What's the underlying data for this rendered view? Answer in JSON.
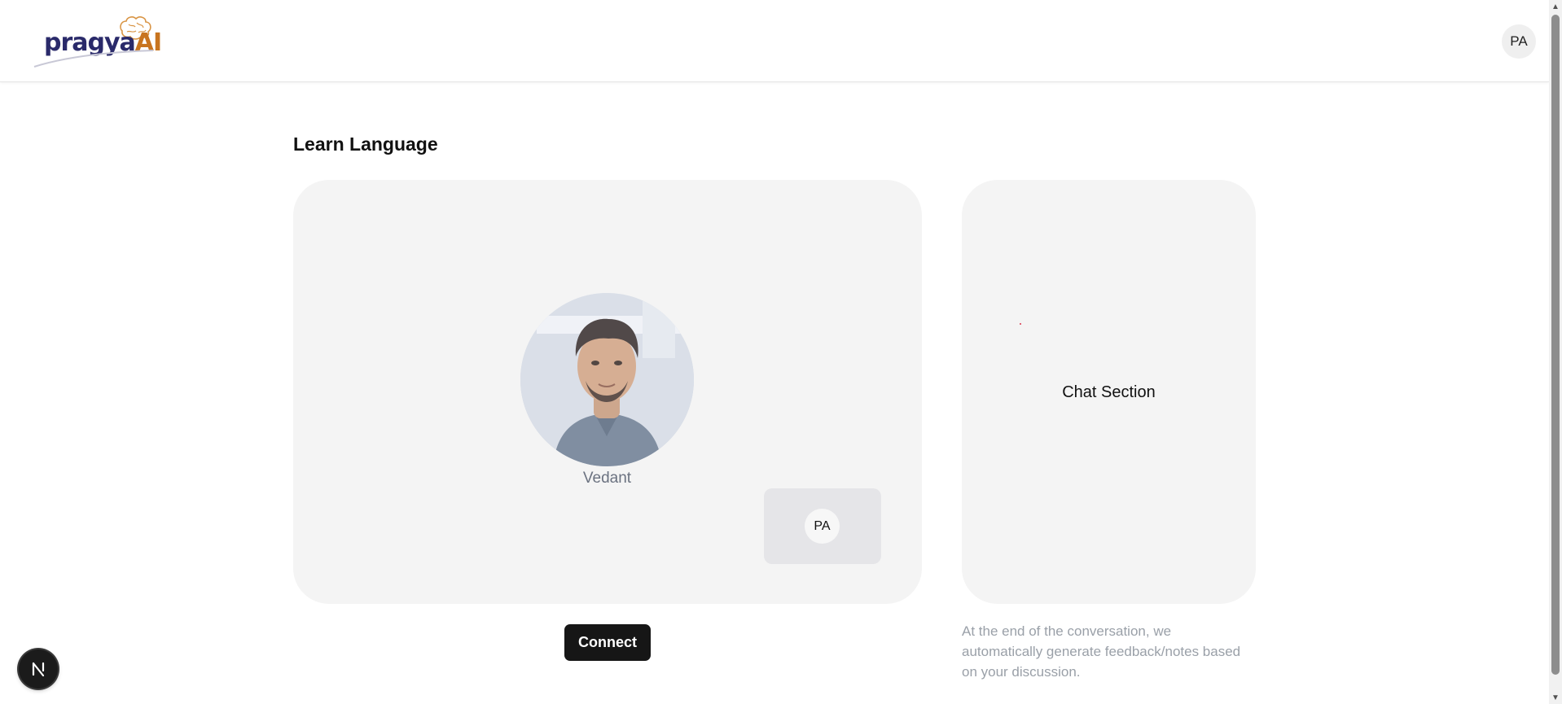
{
  "header": {
    "logo": {
      "text_part1": "pragya",
      "text_part2": "AI"
    },
    "user_initials": "PA"
  },
  "main": {
    "title": "Learn Language",
    "agent": {
      "name": "Vedant"
    },
    "user_tile": {
      "initials": "PA"
    },
    "connect_label": "Connect"
  },
  "chat": {
    "label": "Chat Section",
    "note": "At the end of the conversation, we automatically generate feedback/notes based on your discussion."
  },
  "dev_indicator": {
    "letter": "N"
  },
  "colors": {
    "panel_bg": "#f4f4f4",
    "button_bg": "#161616",
    "muted_text": "#9aa0a8",
    "logo_primary": "#2a2a6a",
    "logo_accent": "#c8741f"
  }
}
